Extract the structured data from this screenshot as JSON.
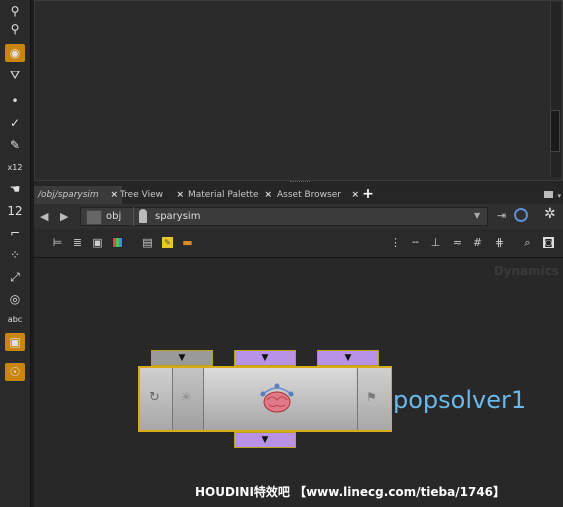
{
  "shelf": {
    "tools": [
      {
        "icon": "pin-icon",
        "glyph": "⚲"
      },
      {
        "icon": "person-pin-icon",
        "glyph": "⚲"
      },
      {
        "icon": "camera-view-icon",
        "glyph": "◉"
      },
      {
        "icon": "sop-select-icon",
        "glyph": "⛛"
      },
      {
        "icon": "dot-icon",
        "glyph": "•"
      },
      {
        "icon": "brush-icon",
        "glyph": "✓"
      },
      {
        "icon": "edit-pen-icon",
        "glyph": "✎"
      },
      {
        "icon": "xy12-icon",
        "glyph": "x12"
      },
      {
        "icon": "hand-icon",
        "glyph": "☚"
      },
      {
        "icon": "handle-12-icon",
        "glyph": "12"
      },
      {
        "icon": "ruler-icon",
        "glyph": "⌐"
      },
      {
        "icon": "grid-dots-icon",
        "glyph": "⁘"
      },
      {
        "icon": "ik-icon",
        "glyph": "⤢"
      },
      {
        "icon": "circle-icon",
        "glyph": "◎"
      },
      {
        "icon": "text-abc-icon",
        "glyph": "abc"
      },
      {
        "icon": "screenshot-icon",
        "glyph": "▣"
      },
      {
        "icon": "orange-light-icon",
        "glyph": "☉"
      }
    ]
  },
  "tabs": [
    {
      "label": "/obj/sparysim",
      "close": "×"
    },
    {
      "label": "Tree View",
      "close": "×"
    },
    {
      "label": "Material Palette",
      "close": "×"
    },
    {
      "label": "Asset Browser",
      "close": "×"
    }
  ],
  "add_tab": "+",
  "path": {
    "root": "obj",
    "node": "sparysim"
  },
  "network_toolbar": {
    "left_icons": [
      "tree-layout-icon",
      "list-view-icon",
      "thumbnail-icon",
      "color-palette-icon",
      "network-box-icon",
      "sticky-note-icon",
      "subnet-icon"
    ],
    "right_icons": [
      "align-vertical-icon",
      "dash-icon",
      "snap-icon",
      "wire-style-icon",
      "grid-icon",
      "grid-points-icon",
      "zoom-icon",
      "screenshot-icon"
    ]
  },
  "context_label": "Dynamics",
  "node": {
    "name": "popsolver1",
    "input_port_glyph": "▼"
  },
  "watermark": "HOUDINI特效吧 【www.linecg.com/tieba/1746】",
  "colors": {
    "shelf_active": "#c8860e",
    "port_gray": "#9a9a9a",
    "port_purple": "#b892e6",
    "node_outline": "#d9ac16",
    "node_name": "#6ab8ea"
  }
}
